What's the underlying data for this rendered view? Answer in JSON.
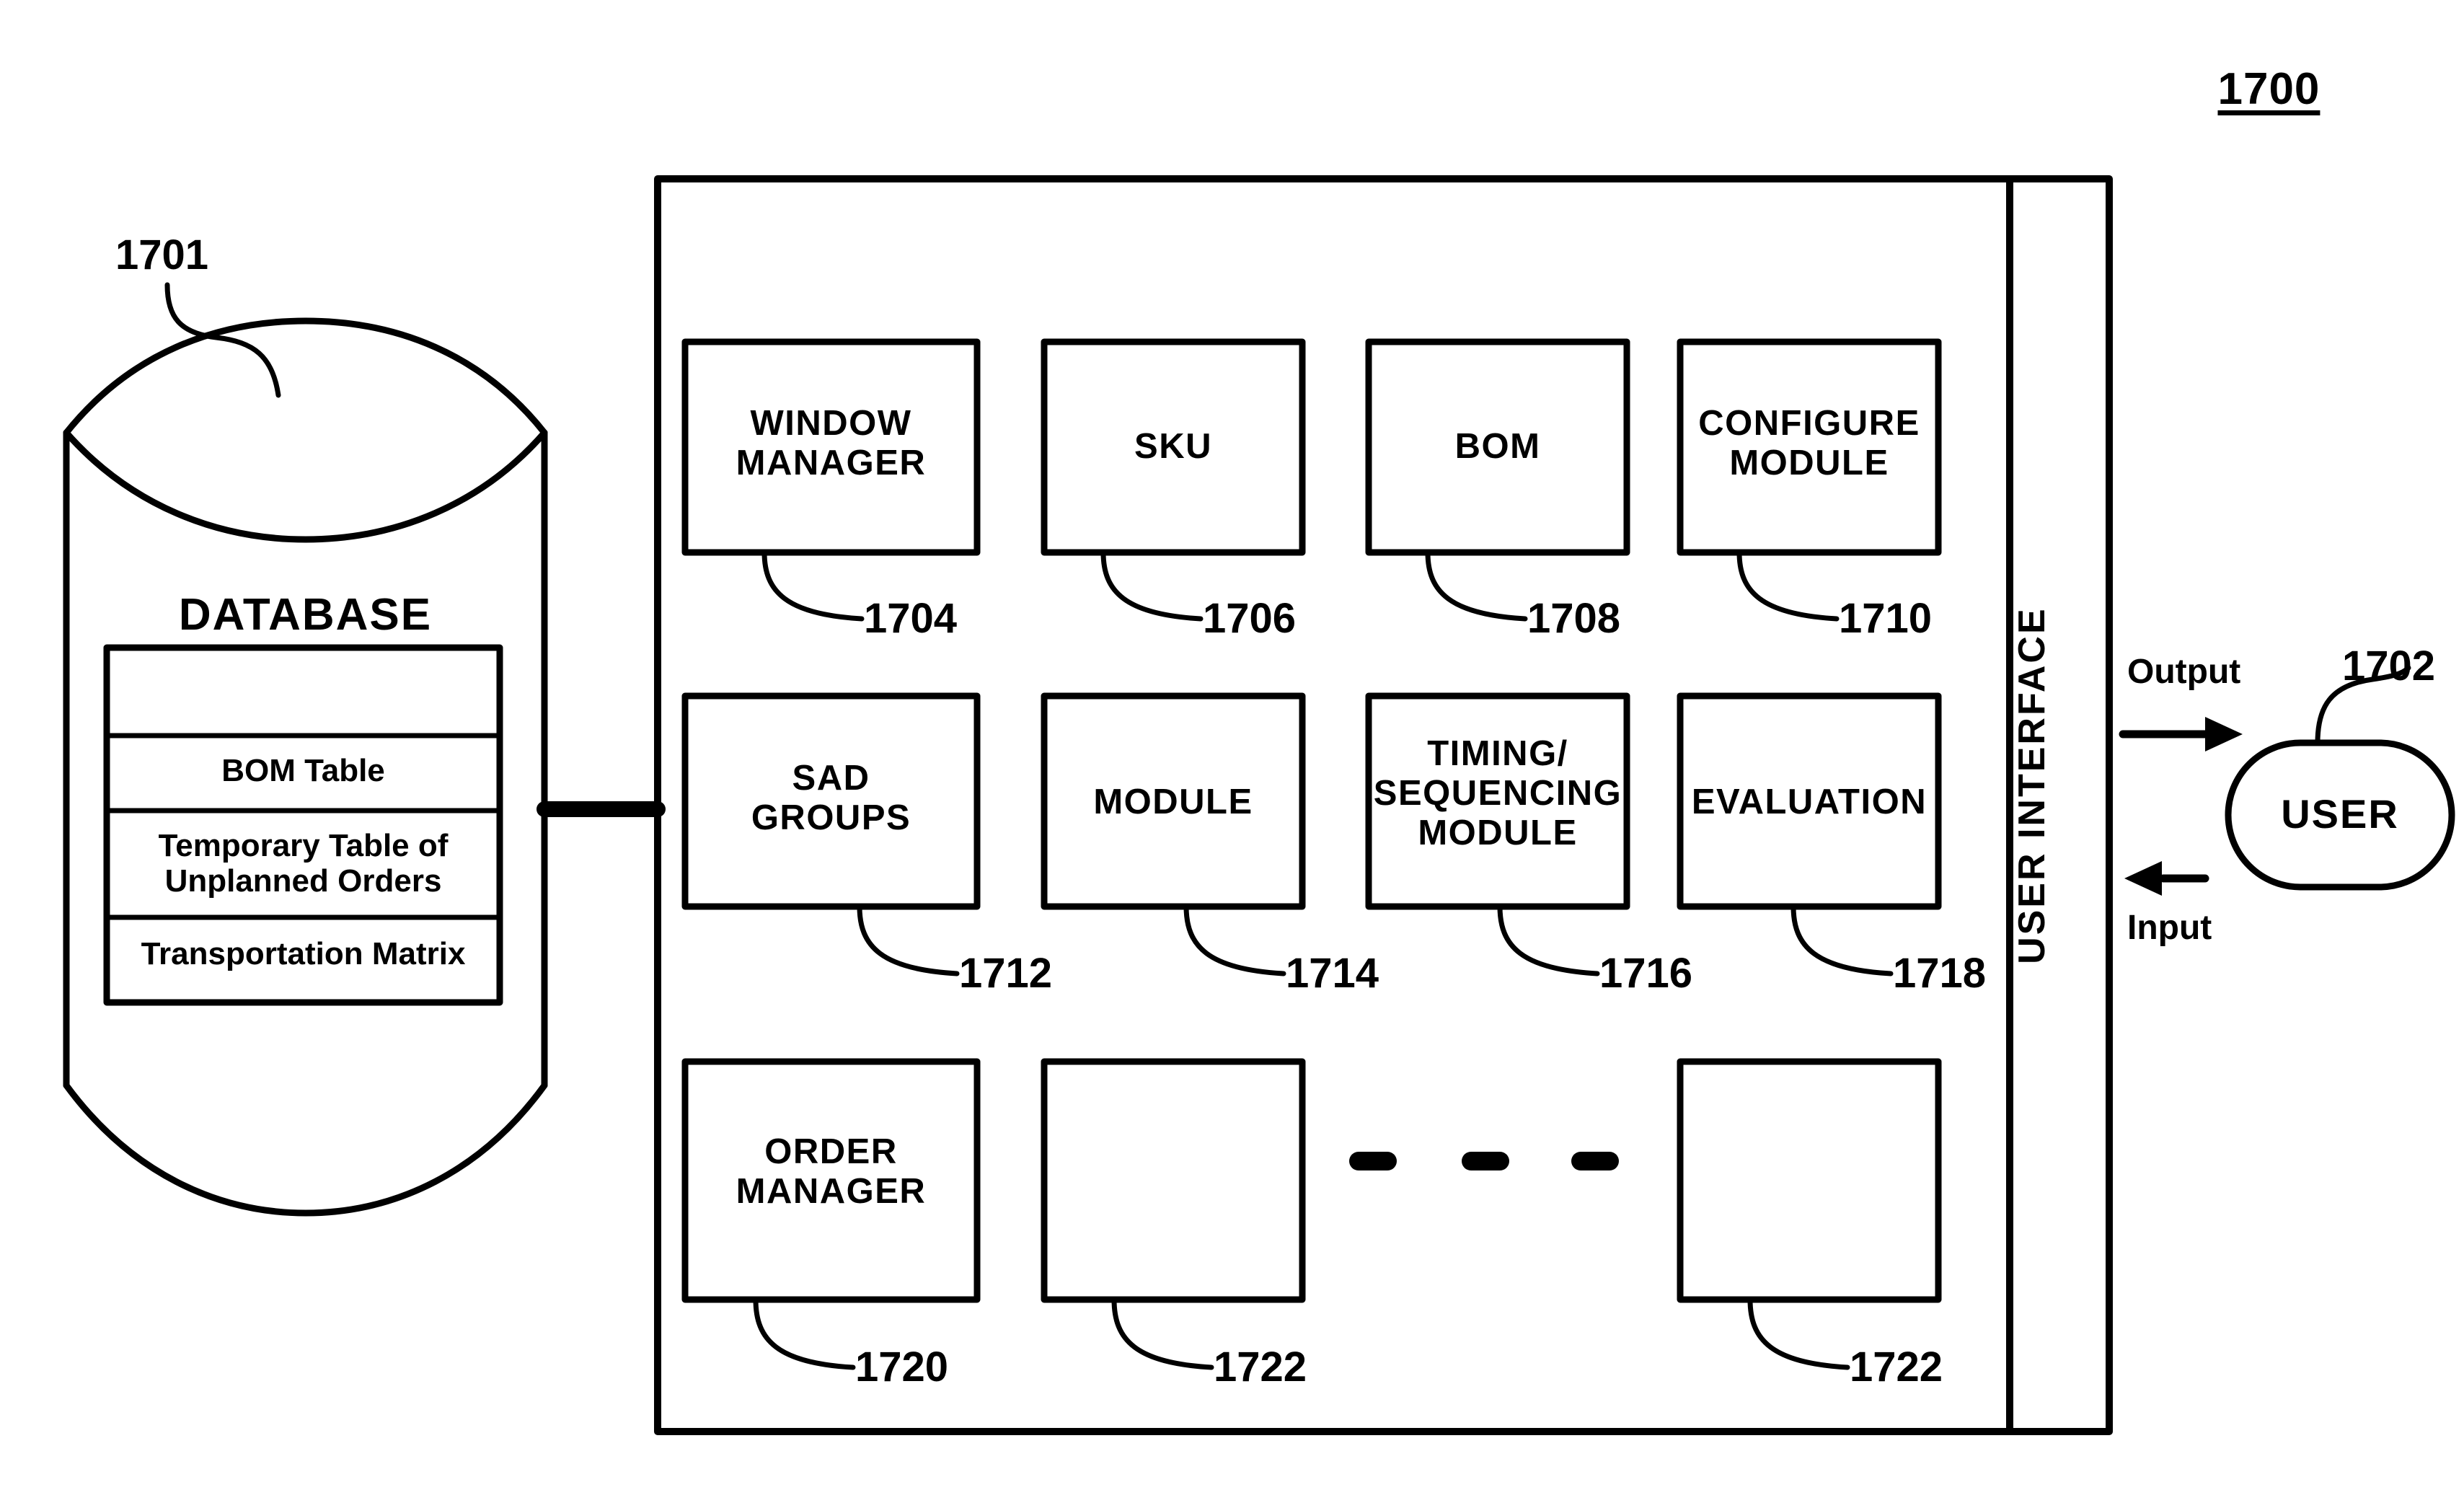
{
  "figure": {
    "number": "1700"
  },
  "database": {
    "ref": "1701",
    "title": "DATABASE",
    "rows": [
      {
        "label": ""
      },
      {
        "label": "BOM Table"
      },
      {
        "label": "Temporary Table of\nUnplanned Orders"
      },
      {
        "label": "Transportation Matrix"
      }
    ]
  },
  "system": {
    "modules": [
      {
        "label": "WINDOW\nMANAGER",
        "ref": "1704"
      },
      {
        "label": "SKU",
        "ref": "1706"
      },
      {
        "label": "BOM",
        "ref": "1708"
      },
      {
        "label": "CONFIGURE\nMODULE",
        "ref": "1710"
      },
      {
        "label": "SAD\nGROUPS",
        "ref": "1712"
      },
      {
        "label": "MODULE",
        "ref": "1714"
      },
      {
        "label": "TIMING/\nSEQUENCING\nMODULE",
        "ref": "1716"
      },
      {
        "label": "EVALUATION",
        "ref": "1718"
      },
      {
        "label": "ORDER\nMANAGER",
        "ref": "1720"
      },
      {
        "label": "",
        "ref": "1722"
      },
      {
        "label": "",
        "ref": "1722"
      }
    ],
    "ellipsis": "• • •"
  },
  "user_interface": {
    "label": "USER INTERFACE"
  },
  "user": {
    "label": "USER",
    "ref": "1702",
    "output_label": "Output",
    "input_label": "Input"
  },
  "colors": {
    "ink": "#000000",
    "paper": "#ffffff"
  }
}
